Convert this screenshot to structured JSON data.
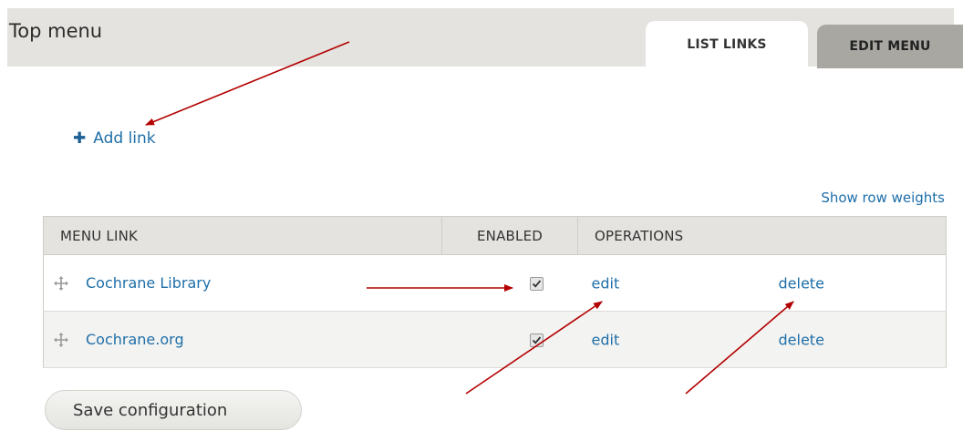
{
  "header": {
    "title": "Top menu",
    "tabs": [
      {
        "label": "LIST LINKS",
        "active": true
      },
      {
        "label": "EDIT MENU",
        "active": false
      }
    ]
  },
  "actions": {
    "add_link_label": "Add link",
    "add_link_icon": "plus-icon",
    "show_row_weights": "Show row weights"
  },
  "table": {
    "columns": [
      "MENU LINK",
      "ENABLED",
      "OPERATIONS"
    ],
    "rows": [
      {
        "title": "Cochrane Library",
        "enabled": true,
        "edit": "edit",
        "delete": "delete"
      },
      {
        "title": "Cochrane.org",
        "enabled": true,
        "edit": "edit",
        "delete": "delete"
      }
    ]
  },
  "footer": {
    "save_label": "Save configuration"
  },
  "colors": {
    "link": "#1f6fa9",
    "header_bg": "#e4e3df",
    "inactive_tab": "#a8a7a2",
    "annotation_arrow": "#b30000"
  }
}
